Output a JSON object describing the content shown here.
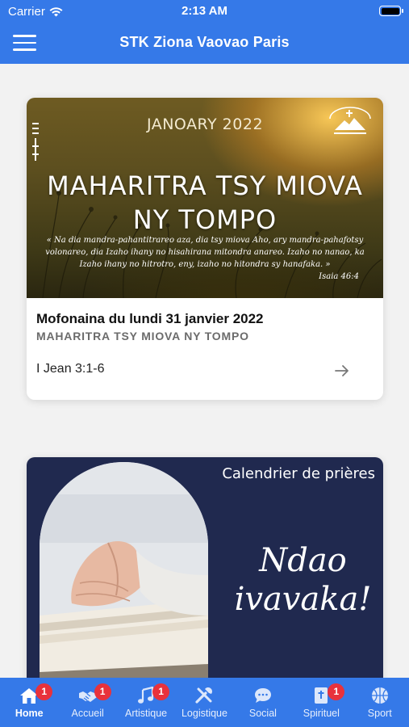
{
  "status_bar": {
    "carrier": "Carrier",
    "time": "2:13 AM"
  },
  "header": {
    "title": "STK Ziona Vaovao Paris"
  },
  "devotional_card": {
    "image": {
      "date_banner": "JANOARY 2022",
      "headline": "MAHARITRA TSY MIOVA\nNY TOMPO",
      "quote": "« Na dia mandra-pahantitrareo aza, dia tsy miova Aho, ary mandra-pahafotsy volonareo, dia Izaho ihany no hisahirana mitondra anareo. Izaho no nanao, ka Izaho ihany no hitrotro, eny, izaho no hitondra sy hanafaka. »",
      "quote_ref": "Isaia 46:4",
      "badge": "ZIONA VAOVAO PARIS"
    },
    "title": "Mofonaina du lundi 31 janvier 2022",
    "subtitle": "MAHARITRA TSY MIOVA NY TOMPO",
    "reference": "I Jean 3:1-6"
  },
  "prayer_card": {
    "label": "Calendrier de prières",
    "script_text": "Ndao\nivavaka!"
  },
  "tab_bar": {
    "items": [
      {
        "label": "Home",
        "icon": "home-icon",
        "badge": "1",
        "active": true
      },
      {
        "label": "Accueil",
        "icon": "handshake-icon",
        "badge": "1"
      },
      {
        "label": "Artistique",
        "icon": "music-note-icon",
        "badge": "1"
      },
      {
        "label": "Logistique",
        "icon": "tools-icon"
      },
      {
        "label": "Social",
        "icon": "chat-bubble-icon"
      },
      {
        "label": "Spirituel",
        "icon": "bible-icon",
        "badge": "1"
      },
      {
        "label": "Sport",
        "icon": "basketball-icon"
      }
    ]
  },
  "colors": {
    "primary": "#3579e8",
    "badge": "#e8323c",
    "prayer_bg": "#20294f"
  }
}
